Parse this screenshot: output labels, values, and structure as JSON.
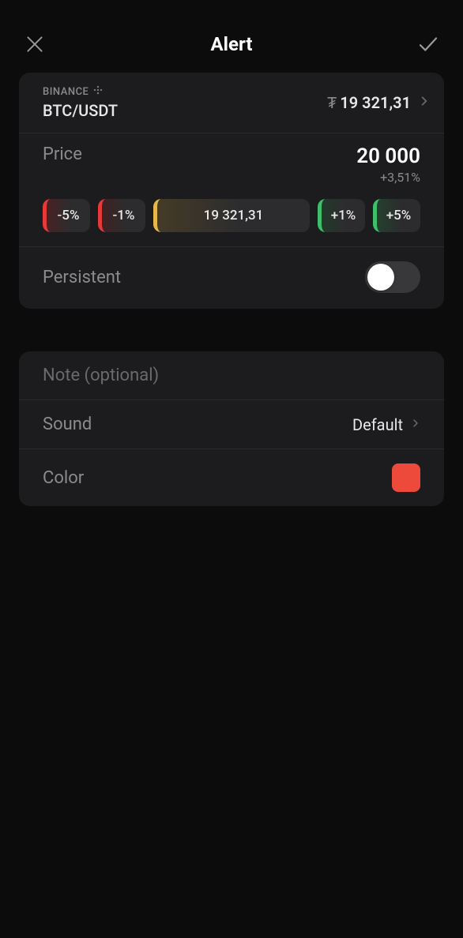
{
  "header": {
    "title": "Alert"
  },
  "symbol": {
    "exchange": "BINANCE",
    "pair": "BTC/USDT",
    "currency_symbol": "₮",
    "current_price": "19 321,31"
  },
  "price": {
    "label": "Price",
    "target": "20 000",
    "pct_change": "+3,51%"
  },
  "chips": {
    "minus5": "-5%",
    "minus1": "-1%",
    "current": "19 321,31",
    "plus1": "+1%",
    "plus5": "+5%"
  },
  "persistent": {
    "label": "Persistent",
    "value": false
  },
  "note": {
    "placeholder": "Note (optional)",
    "value": ""
  },
  "sound": {
    "label": "Sound",
    "value": "Default"
  },
  "color": {
    "label": "Color",
    "value": "#ed4a3c"
  }
}
